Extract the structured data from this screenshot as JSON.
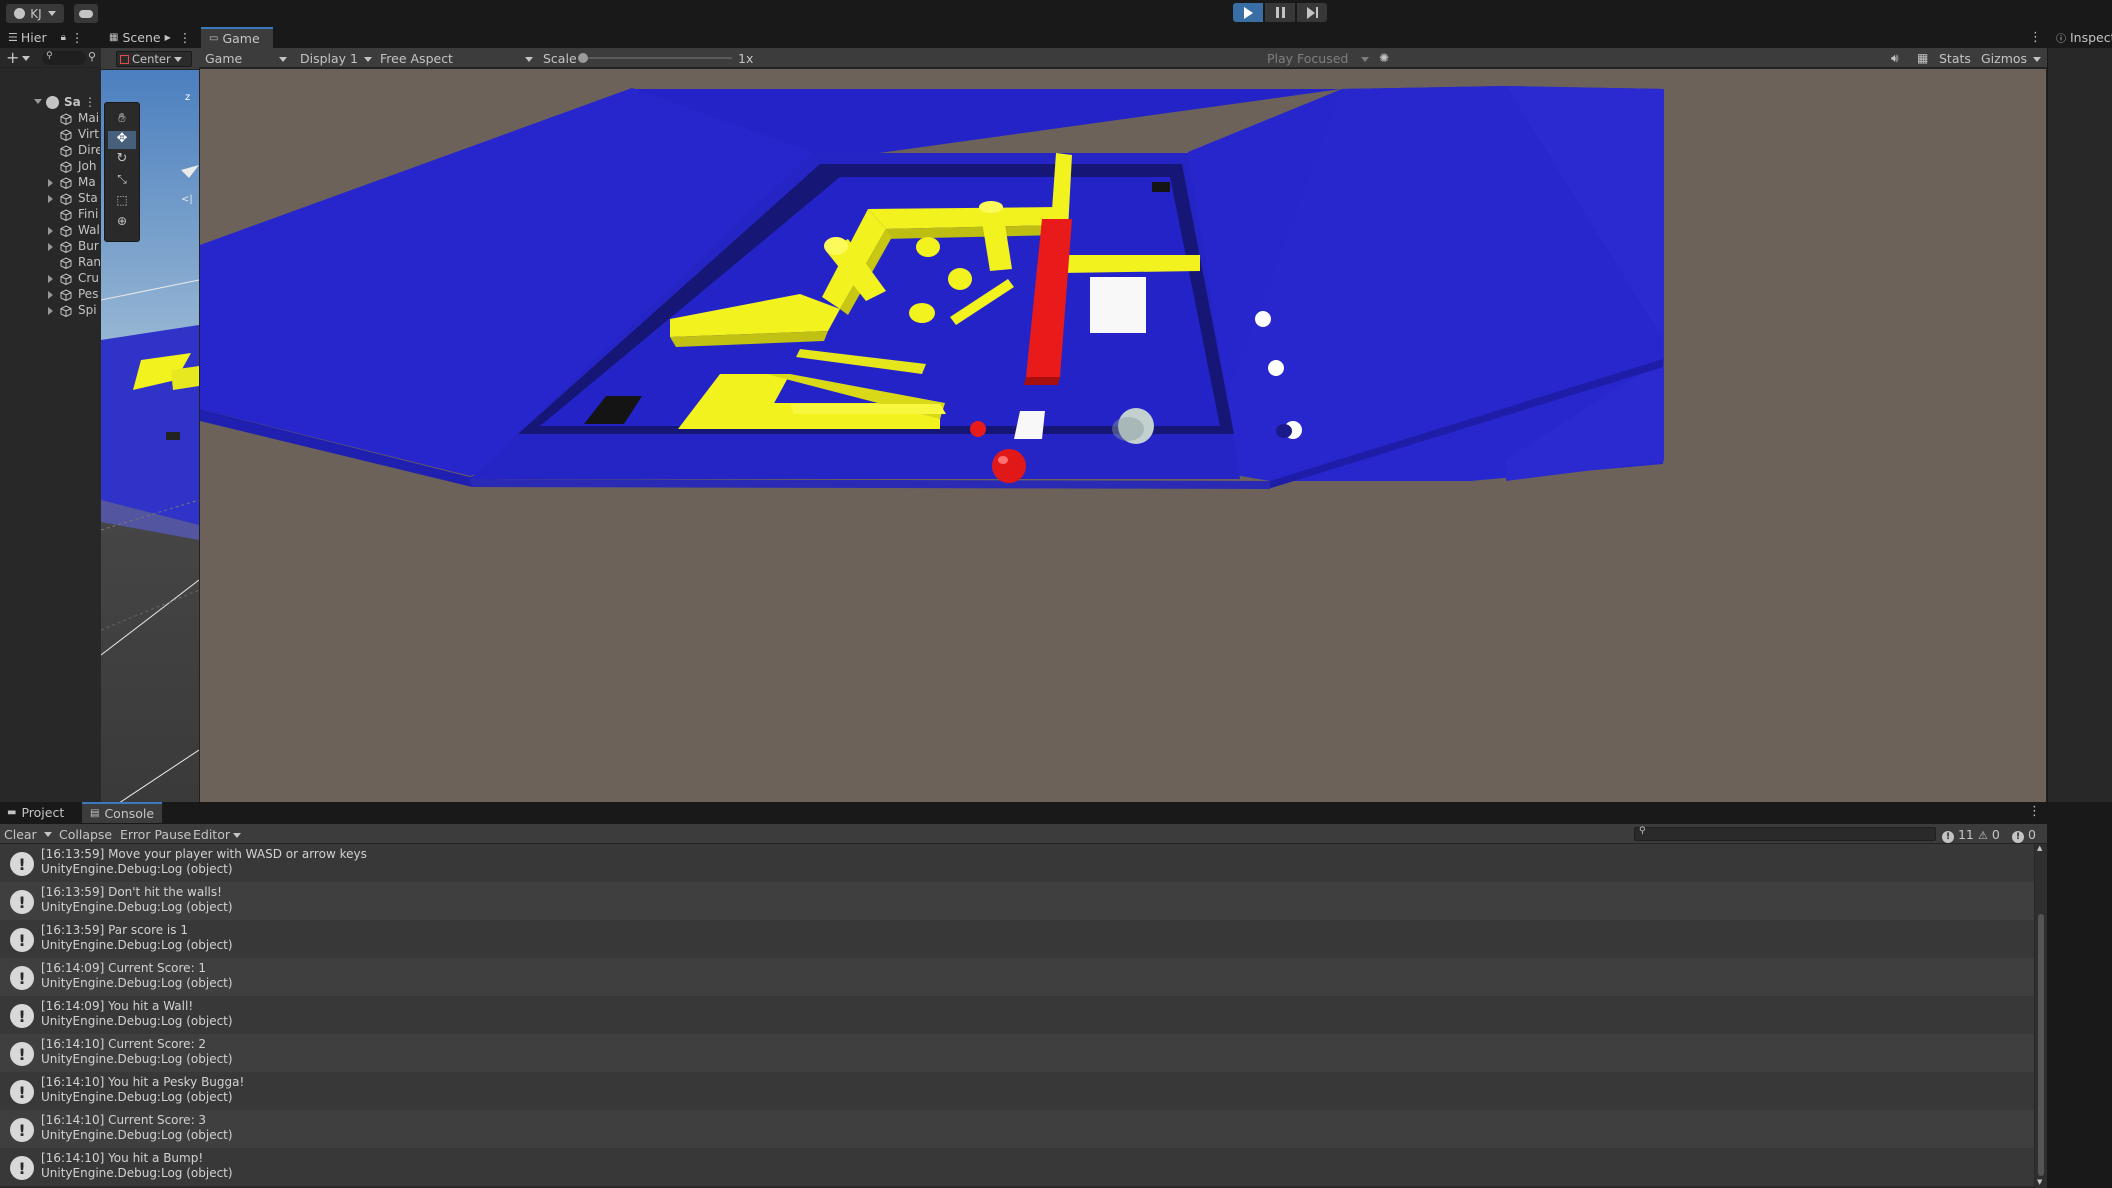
{
  "topbar": {
    "account_label": "KJ",
    "cloud_icon": "cloud-icon",
    "play_icon": "play-icon",
    "pause_icon": "pause-icon",
    "step_icon": "step-icon"
  },
  "hierarchy": {
    "tab_label": "Hier",
    "scene_name": "Sa",
    "items": [
      {
        "label": "Mai",
        "expandable": false
      },
      {
        "label": "Virt",
        "expandable": false
      },
      {
        "label": "Dire",
        "expandable": false
      },
      {
        "label": "Joh",
        "expandable": false
      },
      {
        "label": "Ma",
        "expandable": true
      },
      {
        "label": "Sta",
        "expandable": true
      },
      {
        "label": "Fini",
        "expandable": false
      },
      {
        "label": "Wal",
        "expandable": true
      },
      {
        "label": "Bur",
        "expandable": true
      },
      {
        "label": "Ran",
        "expandable": false
      },
      {
        "label": "Cru",
        "expandable": true
      },
      {
        "label": "Pes",
        "expandable": true
      },
      {
        "label": "Spi",
        "expandable": true
      }
    ]
  },
  "scene": {
    "tab_label": "Scene",
    "pivot_label": "Center",
    "axis_label": "z"
  },
  "game": {
    "tab_label": "Game",
    "mode_label": "Game",
    "display_label": "Display 1",
    "aspect_label": "Free Aspect",
    "scale_label": "Scale",
    "scale_value": "1x",
    "play_focused_label": "Play Focused",
    "stats_label": "Stats",
    "gizmos_label": "Gizmos"
  },
  "inspector": {
    "tab_label": "Inspect"
  },
  "bottom": {
    "project_tab": "Project",
    "console_tab": "Console",
    "clear_label": "Clear",
    "collapse_label": "Collapse",
    "error_pause_label": "Error Pause",
    "editor_label": "Editor",
    "search_placeholder": "",
    "log_count": "11",
    "warn_count": "0",
    "error_count": "0"
  },
  "logs": [
    {
      "line1": "[16:13:59] Move your player with WASD or arrow keys",
      "line2": "UnityEngine.Debug:Log (object)"
    },
    {
      "line1": "[16:13:59] Don't hit the walls!",
      "line2": "UnityEngine.Debug:Log (object)"
    },
    {
      "line1": "[16:13:59] Par score is 1",
      "line2": "UnityEngine.Debug:Log (object)"
    },
    {
      "line1": "[16:14:09] Current Score: 1",
      "line2": "UnityEngine.Debug:Log (object)"
    },
    {
      "line1": "[16:14:09] You hit a Wall!",
      "line2": "UnityEngine.Debug:Log (object)"
    },
    {
      "line1": "[16:14:10] Current Score: 2",
      "line2": "UnityEngine.Debug:Log (object)"
    },
    {
      "line1": "[16:14:10] You hit a Pesky Bugga!",
      "line2": "UnityEngine.Debug:Log (object)"
    },
    {
      "line1": "[16:14:10] Current Score: 3",
      "line2": "UnityEngine.Debug:Log (object)"
    },
    {
      "line1": "[16:14:10] You hit a Bump!",
      "line2": "UnityEngine.Debug:Log (object)"
    }
  ],
  "colors": {
    "board_blue": "#2323c8",
    "wall_yellow": "#f2f21e",
    "red": "#e81a1a",
    "sky": "#6d625a",
    "accent": "#3a79bb"
  }
}
